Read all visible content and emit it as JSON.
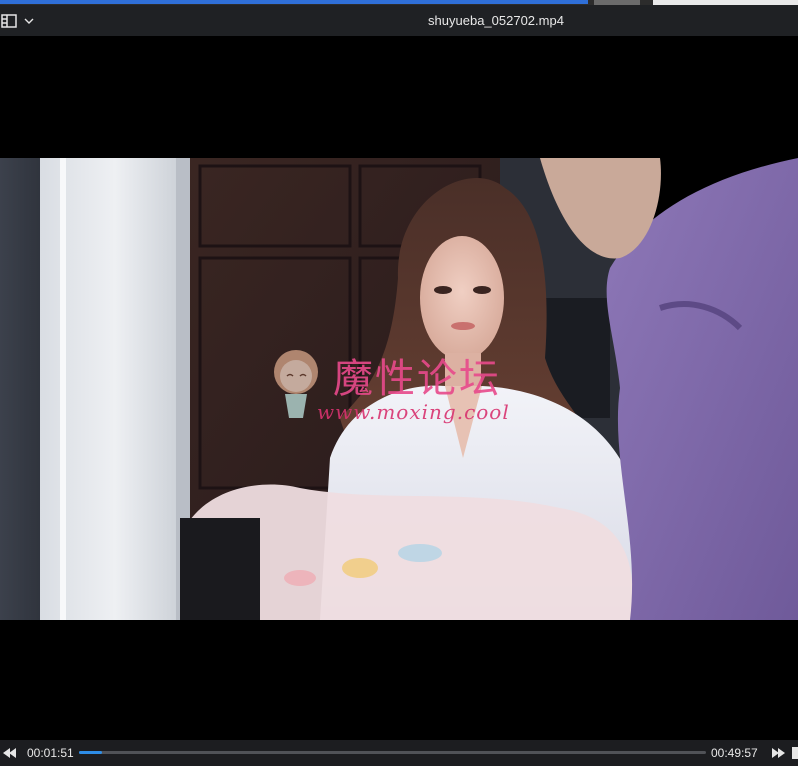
{
  "window": {
    "title": "shuyueba_052702.mp4"
  },
  "player": {
    "watermark_title": "魔性论坛",
    "watermark_url": "www.moxing.cool",
    "current_time": "00:01:51",
    "total_time": "00:49:57",
    "progress_fraction": 0.037
  },
  "icons": {
    "menu": "playlist-icon",
    "dropdown": "chevron-down-icon",
    "prev": "rewind-icon",
    "next": "fast-forward-icon"
  },
  "colors": {
    "accent": "#2e8de6",
    "watermark": "#e84a8b"
  }
}
